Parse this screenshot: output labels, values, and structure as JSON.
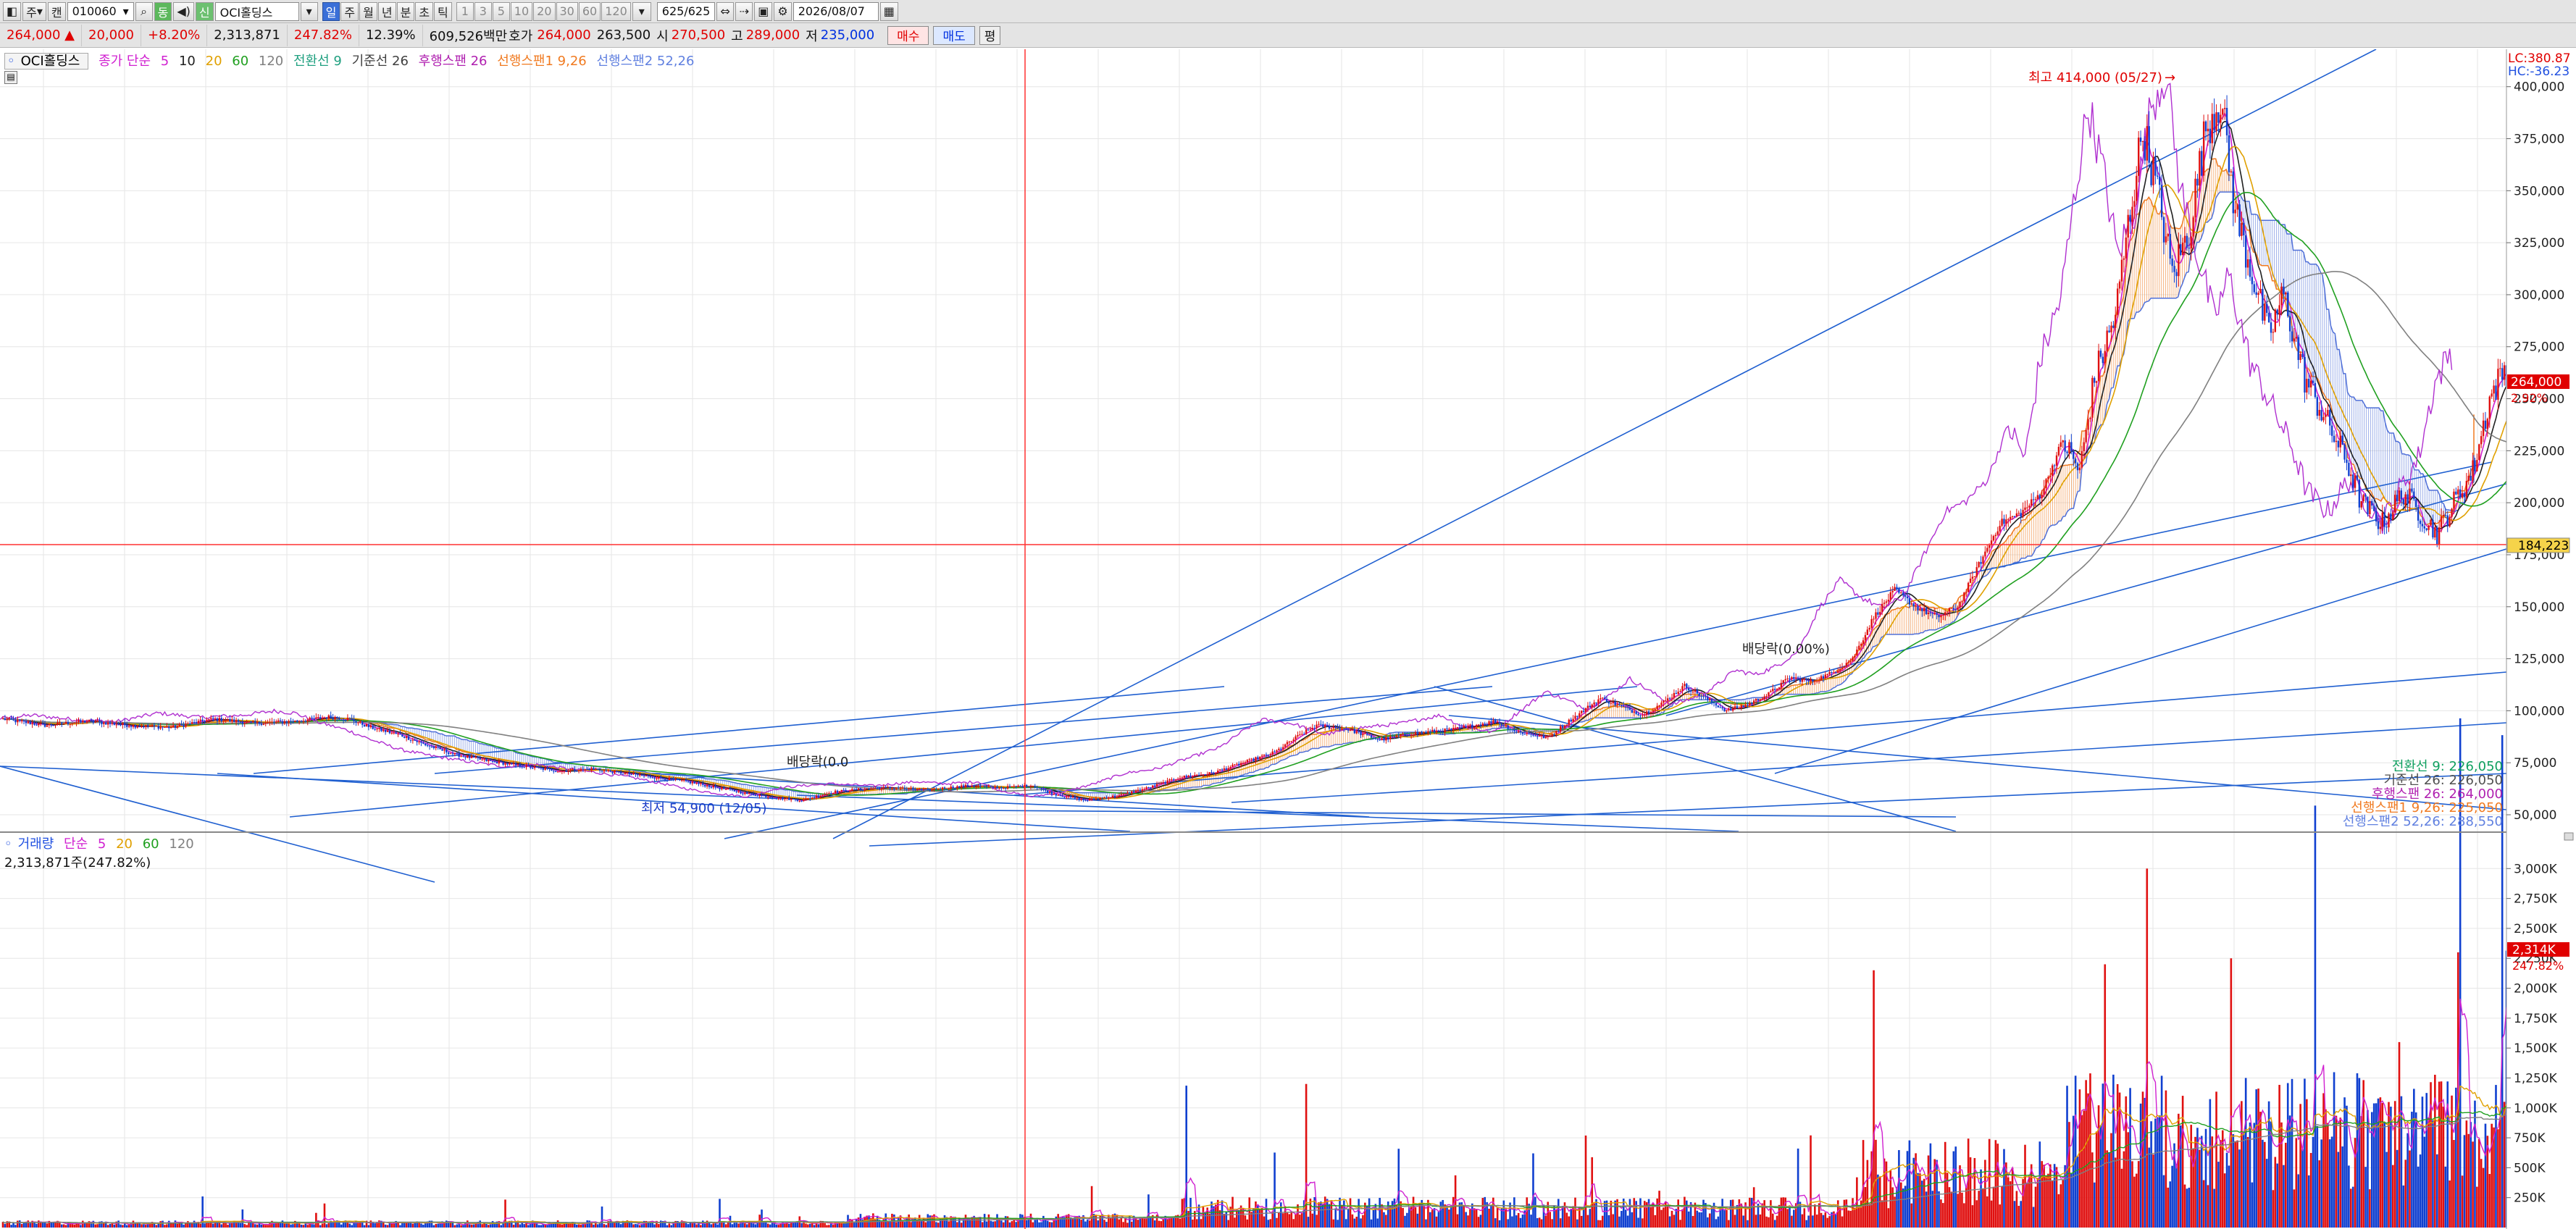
{
  "toolbar": {
    "period_menu": "주",
    "chart_type": "캔",
    "stock_code": "010060",
    "sync_label": "동",
    "group_label": "신",
    "stock_name": "OCI홀딩스",
    "timeframes": [
      "일",
      "주",
      "월",
      "년",
      "분",
      "초",
      "틱"
    ],
    "active_timeframe": "일",
    "intervals": [
      "1",
      "3",
      "5",
      "10",
      "20",
      "30",
      "60",
      "120"
    ],
    "data_count": "625",
    "data_total": "/625",
    "date": "2026/08/07"
  },
  "quote": {
    "price": "264,000",
    "change": "20,000",
    "change_pct": "+8.20%",
    "volume": "2,313,871",
    "volume_ratio": "247.82%",
    "turnover": "12.39%",
    "amount": "609,526백만",
    "ask_label": "호가",
    "ask": "264,000",
    "bid": "263,500",
    "open_label": "시",
    "open": "270,500",
    "high_label": "고",
    "high": "289,000",
    "low_label": "저",
    "low": "235,000",
    "buy_label": "매수",
    "sell_label": "매도",
    "extra_label": "평"
  },
  "legend": {
    "name": "OCI홀딩스",
    "ma_label": "종가 단순",
    "ma_periods": [
      "5",
      "10",
      "20",
      "60",
      "120"
    ],
    "ma_colors": [
      "#d020d0",
      "#202020",
      "#e0a000",
      "#20a020",
      "#808080"
    ],
    "ichimoku": [
      {
        "text": "전환선 9",
        "color": "#20a080"
      },
      {
        "text": "기준선 26",
        "color": "#404040"
      },
      {
        "text": "후행스팬 26",
        "color": "#b020b0"
      },
      {
        "text": "선행스팬1 9,26",
        "color": "#f07a20"
      },
      {
        "text": "선행스팬2 52,26",
        "color": "#6080e0"
      }
    ]
  },
  "price_axis": {
    "ticks": [
      "400,000",
      "375,000",
      "350,000",
      "325,000",
      "300,000",
      "275,000",
      "250,000",
      "225,000",
      "200,000",
      "175,000",
      "150,000",
      "125,000",
      "100,000",
      "75,000",
      "50,000"
    ],
    "lc": "LC:380.87",
    "hc": "HC:-36.23",
    "last_price_box": "264,000",
    "last_pct": "2.92%",
    "crosshair_box": "184,223"
  },
  "annotations": {
    "high": "최고 414,000 (05/27)",
    "low": "최저 54,900 (12/05)",
    "dividend1": "배당락(0.00%)",
    "dividend2": "배당락(0.0"
  },
  "ichimoku_values": [
    {
      "text": "전환선 9: 226,050",
      "color": "#10a060"
    },
    {
      "text": "기준선 26: 226,050",
      "color": "#505050"
    },
    {
      "text": "후행스팬 26: 264,000",
      "color": "#b020b0"
    },
    {
      "text": "선행스팬1 9,26: 225,050",
      "color": "#f07a20"
    },
    {
      "text": "선행스팬2 52,26: 288,550",
      "color": "#6080e0"
    }
  ],
  "volume_legend": {
    "name": "거래량",
    "ma_label": "단순",
    "ma_periods": [
      "5",
      "20",
      "60",
      "120"
    ],
    "ma_colors": [
      "#d020d0",
      "#e0a000",
      "#20a020",
      "#808080"
    ],
    "info": "2,313,871주(247.82%)"
  },
  "volume_axis": {
    "ticks": [
      "3,000K",
      "2,750K",
      "2,500K",
      "2,250K",
      "2,000K",
      "1,750K",
      "1,500K",
      "1,250K",
      "1,000K",
      "750K",
      "500K",
      "250K"
    ],
    "last_box": "2,314K",
    "last_pct": "247.82%"
  },
  "chart_data": {
    "type": "candlestick",
    "price_ylim": [
      42000,
      418000
    ],
    "volume_ylim": [
      0,
      3250000
    ],
    "ichimoku_ranges": [
      [
        30,
        300
      ],
      [
        390,
        490
      ],
      [
        530,
        560
      ],
      [
        620,
        640
      ],
      [
        820,
        880
      ],
      [
        900,
        945
      ]
    ],
    "price_path": [
      [
        0,
        96000
      ],
      [
        20,
        93000
      ],
      [
        40,
        95000
      ],
      [
        60,
        93000
      ],
      [
        80,
        92000
      ],
      [
        100,
        96000
      ],
      [
        120,
        94000
      ],
      [
        140,
        95000
      ],
      [
        155,
        97000
      ],
      [
        165,
        96000
      ],
      [
        175,
        92000
      ],
      [
        190,
        88000
      ],
      [
        200,
        84000
      ],
      [
        215,
        79000
      ],
      [
        230,
        76000
      ],
      [
        250,
        73000
      ],
      [
        265,
        71000
      ],
      [
        280,
        72000
      ],
      [
        295,
        70000
      ],
      [
        310,
        68000
      ],
      [
        325,
        66000
      ],
      [
        340,
        63000
      ],
      [
        355,
        60000
      ],
      [
        370,
        58000
      ],
      [
        380,
        57000
      ],
      [
        395,
        61000
      ],
      [
        405,
        62000
      ],
      [
        420,
        63000
      ],
      [
        440,
        62000
      ],
      [
        460,
        64000
      ],
      [
        475,
        63000
      ],
      [
        490,
        64000
      ],
      [
        500,
        60000
      ],
      [
        515,
        57000
      ],
      [
        530,
        59000
      ],
      [
        545,
        63000
      ],
      [
        560,
        68000
      ],
      [
        575,
        70000
      ],
      [
        590,
        75000
      ],
      [
        605,
        80000
      ],
      [
        615,
        87000
      ],
      [
        625,
        93000
      ],
      [
        640,
        91000
      ],
      [
        655,
        86000
      ],
      [
        670,
        89000
      ],
      [
        690,
        91000
      ],
      [
        710,
        95000
      ],
      [
        720,
        90000
      ],
      [
        735,
        87000
      ],
      [
        745,
        95000
      ],
      [
        760,
        106000
      ],
      [
        770,
        102000
      ],
      [
        780,
        98000
      ],
      [
        790,
        104000
      ],
      [
        800,
        112000
      ],
      [
        810,
        106000
      ],
      [
        820,
        100000
      ],
      [
        830,
        103000
      ],
      [
        840,
        108000
      ],
      [
        850,
        116000
      ],
      [
        860,
        114000
      ],
      [
        870,
        118000
      ],
      [
        880,
        125000
      ],
      [
        890,
        145000
      ],
      [
        900,
        158000
      ],
      [
        910,
        150000
      ],
      [
        920,
        145000
      ],
      [
        930,
        150000
      ],
      [
        940,
        170000
      ],
      [
        950,
        190000
      ],
      [
        960,
        195000
      ],
      [
        970,
        205000
      ],
      [
        980,
        230000
      ],
      [
        988,
        215000
      ],
      [
        995,
        260000
      ],
      [
        1005,
        290000
      ],
      [
        1012,
        340000
      ],
      [
        1018,
        380000
      ],
      [
        1025,
        350000
      ],
      [
        1032,
        310000
      ],
      [
        1040,
        330000
      ],
      [
        1048,
        380000
      ],
      [
        1055,
        395000
      ],
      [
        1062,
        340000
      ],
      [
        1070,
        310000
      ],
      [
        1078,
        280000
      ],
      [
        1085,
        300000
      ],
      [
        1095,
        260000
      ],
      [
        1105,
        240000
      ],
      [
        1115,
        220000
      ],
      [
        1122,
        200000
      ],
      [
        1132,
        190000
      ],
      [
        1142,
        205000
      ],
      [
        1150,
        195000
      ],
      [
        1158,
        185000
      ],
      [
        1166,
        200000
      ],
      [
        1175,
        215000
      ],
      [
        1183,
        250000
      ],
      [
        1190,
        264000
      ]
    ]
  }
}
